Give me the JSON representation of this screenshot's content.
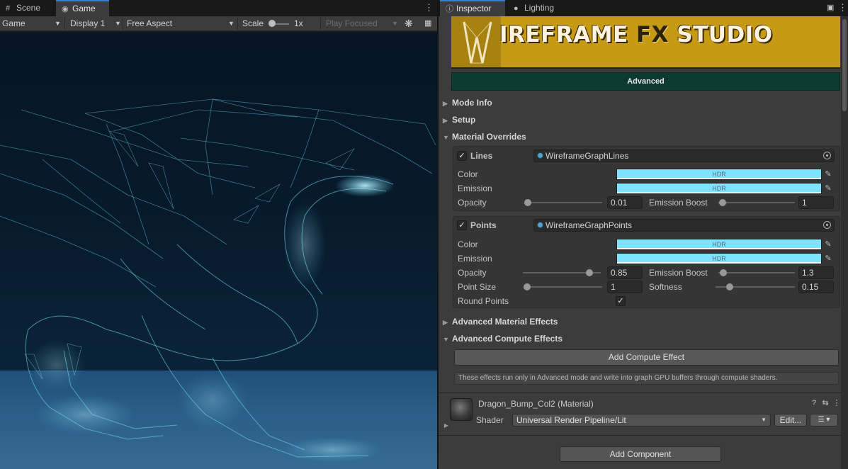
{
  "left_panel": {
    "tabs": [
      {
        "label": "Scene",
        "icon": "grid-icon"
      },
      {
        "label": "Game",
        "icon": "gamepad-icon"
      }
    ],
    "toolbar": {
      "game_dropdown": "Game",
      "display_dropdown": "Display 1",
      "aspect_dropdown": "Free Aspect",
      "scale_label": "Scale",
      "scale_value": "1x",
      "play_mode_dropdown": "Play Focused"
    }
  },
  "right_panel": {
    "tabs": [
      {
        "label": "Inspector",
        "icon": "info-icon"
      },
      {
        "label": "Lighting",
        "icon": "bulb-icon"
      }
    ],
    "banner": {
      "title_a": "IREFRAME ",
      "title_b": "FX",
      "title_c": " STUDIO"
    },
    "mode_button": "Advanced",
    "sections": {
      "mode_info": "Mode Info",
      "setup": "Setup",
      "material_overrides": "Material Overrides",
      "advanced_material_effects": "Advanced Material Effects",
      "advanced_compute_effects": "Advanced Compute Effects"
    },
    "lines": {
      "label": "Lines",
      "enabled": true,
      "material": "WireframeGraphLines",
      "color_label": "Color",
      "color_hdr": "HDR",
      "color_value": "#7ee3ff",
      "emission_label": "Emission",
      "emission_hdr": "HDR",
      "emission_value": "#7ee3ff",
      "opacity_label": "Opacity",
      "opacity_value": "0.01",
      "emission_boost_label": "Emission Boost",
      "emission_boost_value": "1"
    },
    "points": {
      "label": "Points",
      "enabled": true,
      "material": "WireframeGraphPoints",
      "color_label": "Color",
      "color_hdr": "HDR",
      "color_value": "#7ee3ff",
      "emission_label": "Emission",
      "emission_hdr": "HDR",
      "emission_value": "#7ee3ff",
      "opacity_label": "Opacity",
      "opacity_value": "0.85",
      "emission_boost_label": "Emission Boost",
      "emission_boost_value": "1.3",
      "point_size_label": "Point Size",
      "point_size_value": "1",
      "softness_label": "Softness",
      "softness_value": "0.15",
      "round_points_label": "Round Points",
      "round_points": true
    },
    "compute": {
      "add_button": "Add Compute Effect",
      "help_text": "These effects run only in Advanced mode and write into graph GPU buffers through compute shaders."
    },
    "material_component": {
      "name": "Dragon_Bump_Col2 (Material)",
      "shader_label": "Shader",
      "shader_value": "Universal Render Pipeline/Lit",
      "edit_button": "Edit..."
    },
    "add_component_button": "Add Component"
  }
}
